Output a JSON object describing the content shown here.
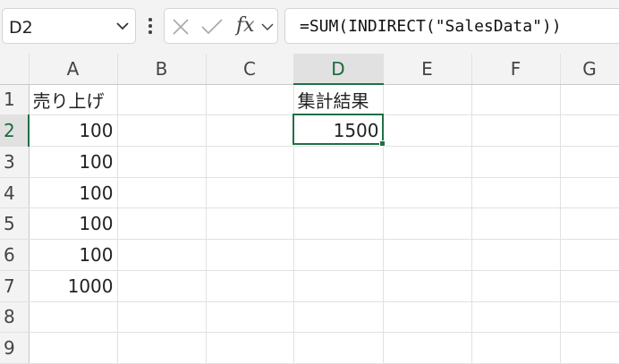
{
  "name_box": {
    "value": "D2"
  },
  "formula_bar": {
    "cancel_icon": "close-icon",
    "enter_icon": "checkmark-icon",
    "fx_label": "fx",
    "formula": "=SUM(INDIRECT(\"SalesData\"))"
  },
  "columns": [
    "A",
    "B",
    "C",
    "D",
    "E",
    "F",
    "G"
  ],
  "rows": [
    {
      "n": "1",
      "A": "売り上げ",
      "B": "",
      "C": "",
      "D": "集計結果",
      "E": "",
      "F": "",
      "G": ""
    },
    {
      "n": "2",
      "A": "100",
      "B": "",
      "C": "",
      "D": "1500",
      "E": "",
      "F": "",
      "G": ""
    },
    {
      "n": "3",
      "A": "100",
      "B": "",
      "C": "",
      "D": "",
      "E": "",
      "F": "",
      "G": ""
    },
    {
      "n": "4",
      "A": "100",
      "B": "",
      "C": "",
      "D": "",
      "E": "",
      "F": "",
      "G": ""
    },
    {
      "n": "5",
      "A": "100",
      "B": "",
      "C": "",
      "D": "",
      "E": "",
      "F": "",
      "G": ""
    },
    {
      "n": "6",
      "A": "100",
      "B": "",
      "C": "",
      "D": "",
      "E": "",
      "F": "",
      "G": ""
    },
    {
      "n": "7",
      "A": "1000",
      "B": "",
      "C": "",
      "D": "",
      "E": "",
      "F": "",
      "G": ""
    },
    {
      "n": "8",
      "A": "",
      "B": "",
      "C": "",
      "D": "",
      "E": "",
      "F": "",
      "G": ""
    },
    {
      "n": "9",
      "A": "",
      "B": "",
      "C": "",
      "D": "",
      "E": "",
      "F": "",
      "G": ""
    }
  ],
  "selection": {
    "cell": "D2",
    "column": "D",
    "row": "2"
  },
  "colors": {
    "accent": "#1e7145",
    "header_bg": "#f3f3f3",
    "selected_header_bg": "#e1e1e1",
    "gridline": "#e1e1e1"
  }
}
